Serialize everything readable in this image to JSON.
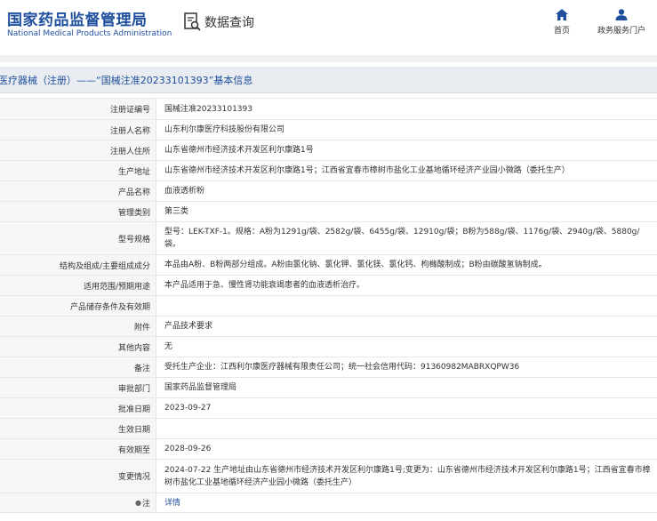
{
  "header": {
    "logo_cn": "国家药品监督管理局",
    "logo_en": "National Medical Products Administration",
    "query_label": "数据查询",
    "nav": [
      {
        "label": "首页",
        "icon": "home-icon"
      },
      {
        "label": "政务服务门户",
        "icon": "user-icon"
      }
    ]
  },
  "title": "医疗器械（注册）——“国械注准20233101393”基本信息",
  "rows": [
    {
      "label": "注册证编号",
      "value": "国械注准20233101393"
    },
    {
      "label": "注册人名称",
      "value": "山东利尔康医疗科技股份有限公司"
    },
    {
      "label": "注册人住所",
      "value": "山东省德州市经济技术开发区利尔康路1号"
    },
    {
      "label": "生产地址",
      "value": "山东省德州市经济技术开发区利尔康路1号；江西省宜春市樟树市盐化工业基地循环经济产业园小微路（委托生产）"
    },
    {
      "label": "产品名称",
      "value": "血液透析粉"
    },
    {
      "label": "管理类别",
      "value": "第三类"
    },
    {
      "label": "型号规格",
      "value": "型号：LEK-TXF-1。规格：A粉为1291g/袋、2582g/袋、6455g/袋、12910g/袋；B粉为588g/袋、1176g/袋、2940g/袋、5880g/袋。"
    },
    {
      "label": "结构及组成/主要组成成分",
      "value": "本品由A粉、B粉两部分组成。A粉由氯化钠、氯化钾、氯化镁、氯化钙、枸橼酸制成；B粉由碳酸氢钠制成。"
    },
    {
      "label": "适用范围/预期用途",
      "value": "本产品适用于急、慢性肾功能衰竭患者的血液透析治疗。"
    },
    {
      "label": "产品储存条件及有效期",
      "value": ""
    },
    {
      "label": "附件",
      "value": "产品技术要求"
    },
    {
      "label": "其他内容",
      "value": "无"
    },
    {
      "label": "备注",
      "value": "受托生产企业：江西利尔康医疗器械有限责任公司；统一社会信用代码：91360982MABRXQPW36"
    },
    {
      "label": "审批部门",
      "value": "国家药品监督管理局"
    },
    {
      "label": "批准日期",
      "value": "2023-09-27"
    },
    {
      "label": "生效日期",
      "value": ""
    },
    {
      "label": "有效期至",
      "value": "2028-09-26"
    },
    {
      "label": "变更情况",
      "value": "2024-07-22 生产地址由山东省德州市经济技术开发区利尔康路1号;变更为：山东省德州市经济技术开发区利尔康路1号；江西省宜春市樟树市盐化工业基地循环经济产业园小微路（委托生产）"
    },
    {
      "label": "注",
      "value": "详情"
    }
  ],
  "colors": {
    "brand_blue": "#1f4f9d",
    "label_bg": "#f6f6f6",
    "title_bar_bg": "#e9ecf0"
  }
}
